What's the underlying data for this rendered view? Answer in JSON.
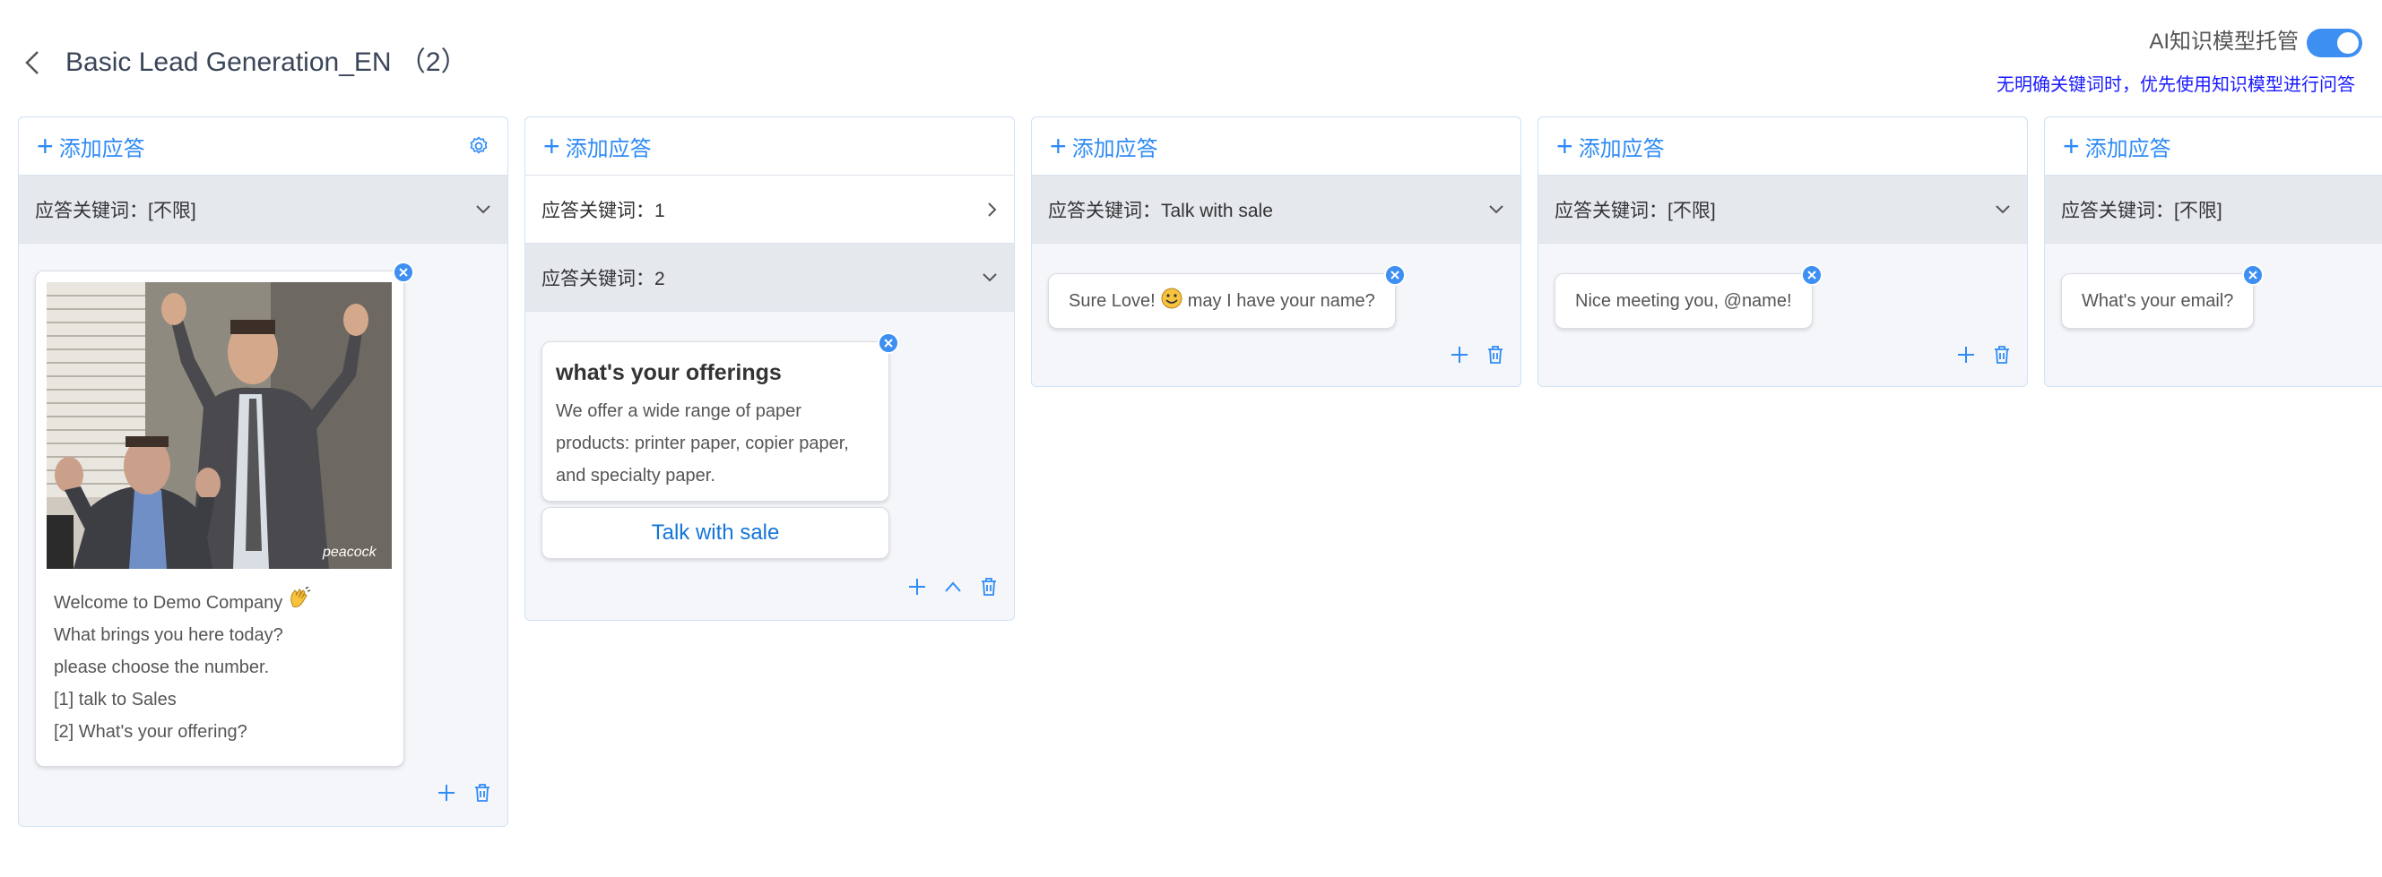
{
  "header": {
    "title": "Basic Lead Generation_EN （2）",
    "ai_toggle_label": "AI知识模型托管",
    "ai_toggle_on": true,
    "ai_hint": "无明确关键词时，优先使用知识模型进行问答"
  },
  "colors": {
    "accent": "#2f8bf5",
    "toggle": "#3d8ff2",
    "hint": "#1a1aff",
    "link": "#1476d8"
  },
  "columns": [
    {
      "add_label": "添加应答",
      "keywords": [
        {
          "label": "应答关键词：[不限]",
          "selected": true
        }
      ],
      "card": {
        "type": "image-text",
        "watermark": "peacock",
        "lines": [
          "Welcome to Demo Company",
          "What brings you here today?",
          "please choose the number.",
          "[1] talk to Sales",
          "[2] What's your offering?"
        ]
      }
    },
    {
      "add_label": "添加应答",
      "keywords": [
        {
          "label": "应答关键词：1",
          "selected": false
        },
        {
          "label": "应答关键词：2",
          "selected": true
        }
      ],
      "card": {
        "type": "rich",
        "title": "what's your offerings",
        "description": [
          "We offer a wide range of paper",
          "products: printer paper, copier paper,",
          "and specialty paper."
        ],
        "button_label": "Talk with sale"
      }
    },
    {
      "add_label": "添加应答",
      "keywords": [
        {
          "label": "应答关键词：Talk with sale",
          "selected": true
        }
      ],
      "card": {
        "type": "text",
        "text_before": "Sure Love!",
        "text_after": "may I have your name?"
      }
    },
    {
      "add_label": "添加应答",
      "keywords": [
        {
          "label": "应答关键词：[不限]",
          "selected": true
        }
      ],
      "card": {
        "type": "text",
        "text": "Nice meeting you, @name!"
      }
    },
    {
      "add_label": "添加应答",
      "keywords": [
        {
          "label": "应答关键词：[不限]",
          "selected": true
        }
      ],
      "card": {
        "type": "text",
        "text": "What's your email?"
      }
    }
  ]
}
